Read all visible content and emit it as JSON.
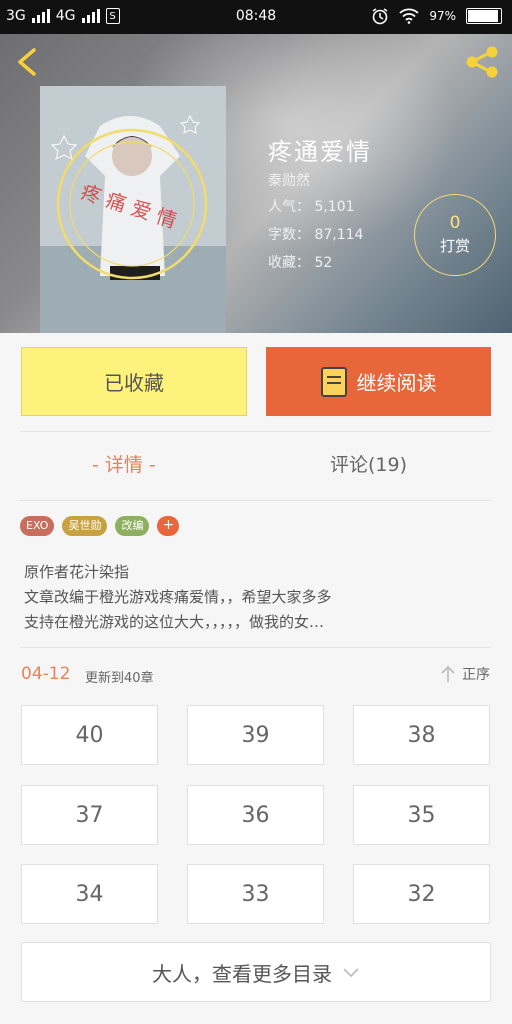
{
  "status_bar": {
    "network1": "3G",
    "network2": "4G",
    "sim_label": "S",
    "time": "08:48",
    "battery": "97%",
    "battery_level": 0.97
  },
  "book": {
    "title": "疼通爱情",
    "author": "秦勋然",
    "popularity": "人气： 5,101",
    "word_count": "字数： 87,114",
    "favorites": "收藏： 52",
    "reward_count": "0",
    "reward_label": "打赏"
  },
  "actions": {
    "collected_label": "已收藏",
    "read_label": "继续阅读"
  },
  "tabs": {
    "details": "- 详情 -",
    "comments": "评论(19)"
  },
  "tags": [
    {
      "label": "EXO",
      "color": "#c76e5c"
    },
    {
      "label": "吴世勋",
      "color": "#c9a240"
    },
    {
      "label": "改编",
      "color": "#8db060"
    },
    {
      "label": "+",
      "color": "#e8663a"
    }
  ],
  "description": [
    "原作者花汁染指",
    "文章改编于橙光游戏疼痛爱情，，希望大家多多",
    "支持在橙光游戏的这位大大，，，，，做我的女…"
  ],
  "update": {
    "date": "04-12",
    "text": "更新到40章",
    "sort_label": "正序"
  },
  "chapters": [
    "40",
    "39",
    "38",
    "37",
    "36",
    "35",
    "34",
    "33",
    "32"
  ],
  "more_label": "大人，查看更多目录",
  "colors": {
    "accent": "#e8663a",
    "collected_bg": "#fdf27b",
    "reward_border": "#f4d77a"
  }
}
